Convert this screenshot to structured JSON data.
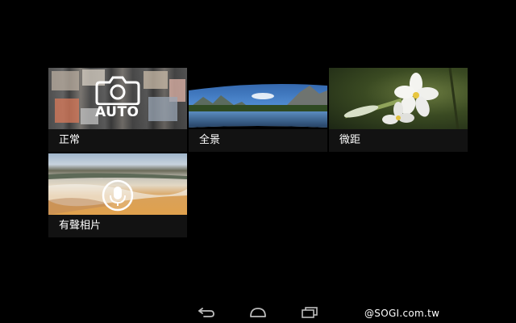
{
  "modes": [
    {
      "id": "normal",
      "label": "正常",
      "overlay_text": "AUTO",
      "icon": "camera-icon"
    },
    {
      "id": "panorama",
      "label": "全景"
    },
    {
      "id": "macro",
      "label": "微距"
    },
    {
      "id": "sound_photo",
      "label": "有聲相片",
      "icon": "microphone-icon"
    }
  ],
  "nav_bar": {
    "back_icon": "back-icon",
    "home_icon": "home-icon",
    "recent_icon": "recent-apps-icon"
  },
  "watermark": "@SOGI.com.tw",
  "colors": {
    "background": "#000000",
    "label_bar": "#141414",
    "label_text": "#ffffff"
  }
}
